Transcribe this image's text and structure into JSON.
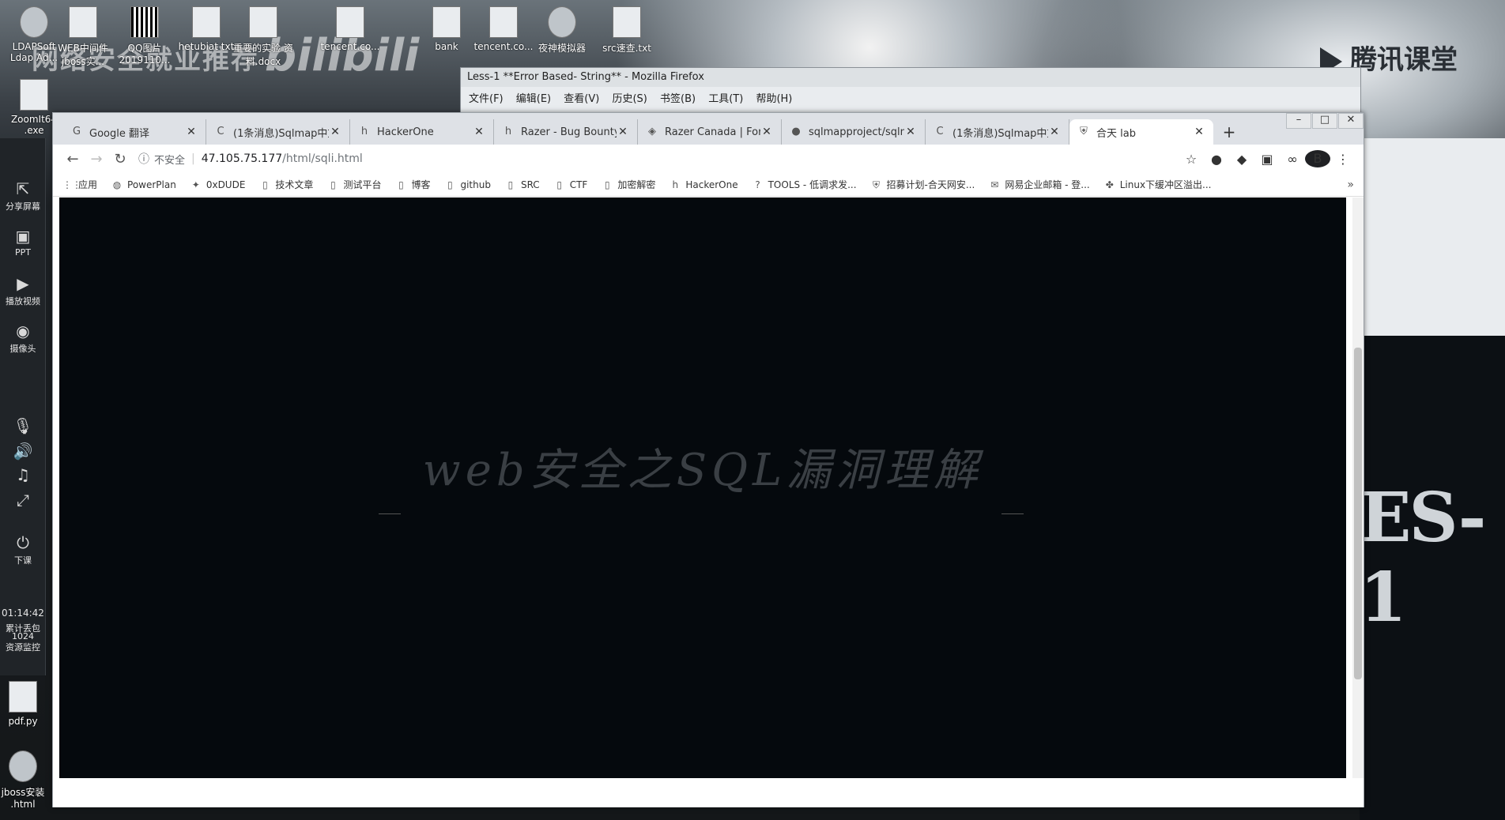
{
  "desktop": {
    "watermark": "网络安全就业推荐",
    "bili_watermark": "bilibili",
    "tencent_logo": "腾讯课堂",
    "icons": [
      {
        "label": "LDAPSoft Ldap Ad..."
      },
      {
        "label": "WEB中间件 jboss实..."
      },
      {
        "label": "QQ图片 2019110..."
      },
      {
        "label": "hetubiat txt"
      },
      {
        "label": "重要的实验 资料.docx"
      },
      {
        "label": "tencent.co..."
      },
      {
        "label": "bank"
      },
      {
        "label": "tencent.co..."
      },
      {
        "label": "夜神模拟器"
      },
      {
        "label": "src速查.txt"
      },
      {
        "label": "ZoomIt64 .exe"
      },
      {
        "label": "pdf.py"
      },
      {
        "label": "jboss安装 .html"
      }
    ]
  },
  "sidebar": {
    "items": [
      {
        "label": "分享屏幕"
      },
      {
        "label": "PPT"
      },
      {
        "label": "播放视频"
      },
      {
        "label": "摄像头"
      },
      {
        "label": "下课"
      }
    ],
    "time": "01:14:42",
    "stats_label": "累计丢包",
    "stats_value": "1024",
    "monitor_label": "资源监控"
  },
  "firefox": {
    "title": "Less-1 **Error Based- String** - Mozilla Firefox",
    "menu": [
      "文件(F)",
      "编辑(E)",
      "查看(V)",
      "历史(S)",
      "书签(B)",
      "工具(T)",
      "帮助(H)"
    ]
  },
  "chrome": {
    "tabs": [
      {
        "label": "Google 翻译",
        "icon": "google-translate-icon"
      },
      {
        "label": "(1条消息)Sqlmap中文",
        "icon": "csdn-icon"
      },
      {
        "label": "HackerOne",
        "icon": "hackerone-icon"
      },
      {
        "label": "Razer - Bug Bounty",
        "icon": "hackerone-icon"
      },
      {
        "label": "Razer Canada | For",
        "icon": "razer-icon"
      },
      {
        "label": "sqlmapproject/sqlm",
        "icon": "github-icon"
      },
      {
        "label": "(1条消息)Sqlmap中文",
        "icon": "csdn-icon"
      },
      {
        "label": "合天 lab",
        "icon": "shield-icon",
        "active": true
      }
    ],
    "omnibox": {
      "insecure_label": "不安全",
      "host": "47.105.75.177",
      "path": "/html/sqli.html"
    },
    "bookmarks": [
      {
        "label": "应用",
        "icon": "apps-icon"
      },
      {
        "label": "PowerPlan",
        "icon": "globe-icon"
      },
      {
        "label": "0xDUDE",
        "icon": "twitter-icon"
      },
      {
        "label": "技术文章",
        "icon": "folder-icon"
      },
      {
        "label": "测试平台",
        "icon": "folder-icon"
      },
      {
        "label": "博客",
        "icon": "folder-icon"
      },
      {
        "label": "github",
        "icon": "folder-icon"
      },
      {
        "label": "SRC",
        "icon": "folder-icon"
      },
      {
        "label": "CTF",
        "icon": "folder-icon"
      },
      {
        "label": "加密解密",
        "icon": "folder-icon"
      },
      {
        "label": "HackerOne",
        "icon": "hackerone-icon"
      },
      {
        "label": "TOOLS - 低调求发...",
        "icon": "tools-icon"
      },
      {
        "label": "招募计划-合天网安...",
        "icon": "shield-icon"
      },
      {
        "label": "网易企业邮箱 - 登...",
        "icon": "mail-icon"
      },
      {
        "label": "Linux下缓冲区溢出...",
        "icon": "linux-icon"
      }
    ],
    "avatar_letter": "B"
  },
  "page": {
    "hero_title": "web安全之SQL漏洞理解"
  },
  "behind": {
    "less_text": "ES-1"
  }
}
